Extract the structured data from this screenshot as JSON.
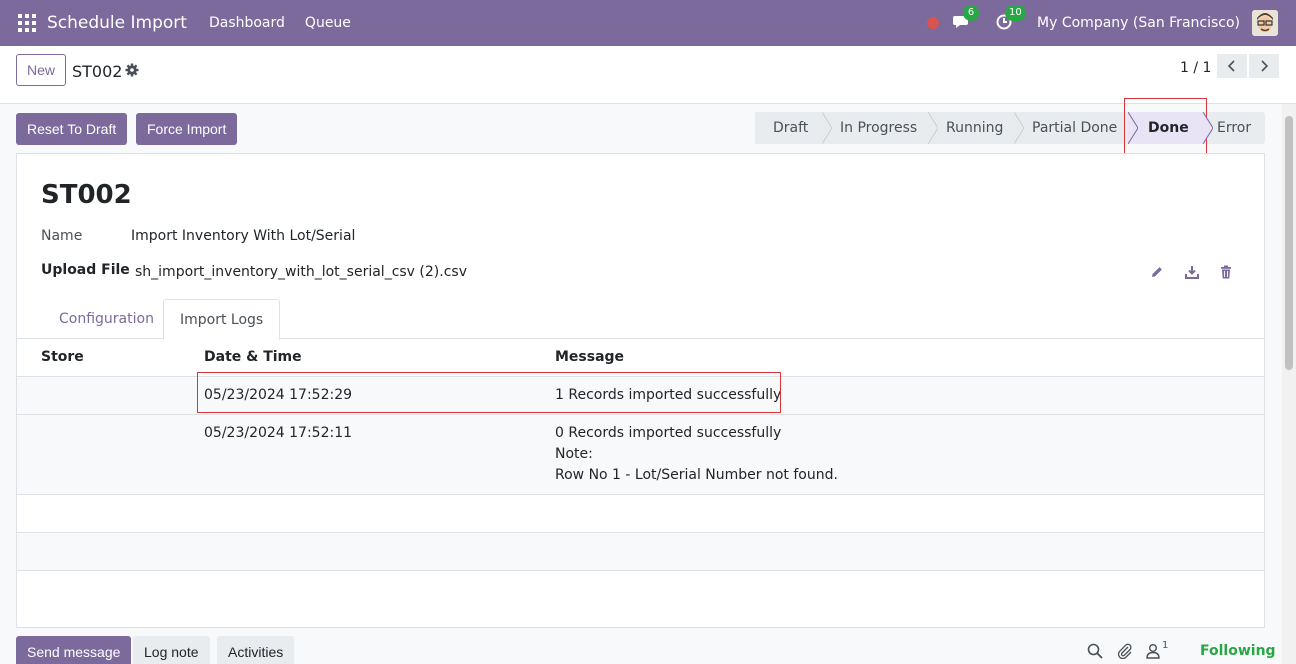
{
  "navbar": {
    "app_title": "Schedule Import",
    "menu": [
      "Dashboard",
      "Queue"
    ],
    "messages_badge": "6",
    "activities_badge": "10",
    "company": "My Company (San Francisco)",
    "bar_color": "#7c6a9c"
  },
  "control": {
    "new_label": "New",
    "record_name": "ST002",
    "pager": "1 / 1"
  },
  "actions": {
    "reset_label": "Reset To Draft",
    "force_label": "Force Import"
  },
  "status_bar": {
    "stages": [
      "Draft",
      "In Progress",
      "Running",
      "Partial Done",
      "Done",
      "Error"
    ],
    "active": "Done"
  },
  "form": {
    "title": "ST002",
    "name_label": "Name",
    "name_value": "Import Inventory With Lot/Serial",
    "upload_label": "Upload File",
    "upload_value": "sh_import_inventory_with_lot_serial_csv (2).csv",
    "tabs": [
      "Configuration",
      "Import Logs"
    ],
    "active_tab": "Import Logs"
  },
  "logs": {
    "columns": [
      "Store",
      "Date & Time",
      "Message"
    ],
    "rows": [
      {
        "store": "",
        "datetime": "05/23/2024 17:52:29",
        "message": [
          "1 Records imported successfully"
        ]
      },
      {
        "store": "",
        "datetime": "05/23/2024 17:52:11",
        "message": [
          "0 Records imported successfully",
          "Note:",
          "Row No 1  - Lot/Serial Number not found."
        ]
      }
    ]
  },
  "chatter": {
    "send_label": "Send message",
    "log_label": "Log note",
    "activities_label": "Activities",
    "followers_count": "1",
    "following_label": "Following"
  }
}
